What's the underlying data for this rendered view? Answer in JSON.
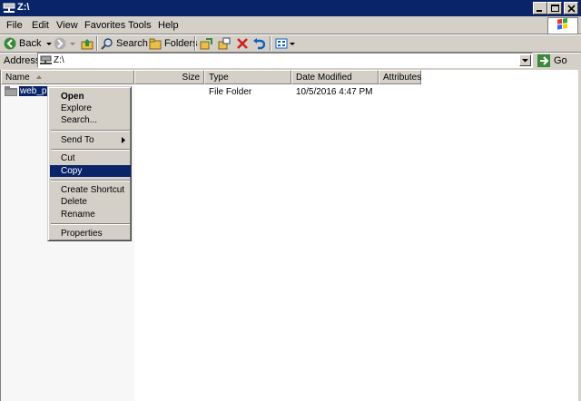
{
  "window": {
    "title": "Z:\\"
  },
  "menu": [
    "File",
    "Edit",
    "View",
    "Favorites",
    "Tools",
    "Help"
  ],
  "toolbar": {
    "back_label": "Back",
    "search_label": "Search",
    "folders_label": "Folders"
  },
  "address": {
    "label": "Address",
    "value": "Z:\\",
    "go_label": "Go"
  },
  "columns": {
    "name": "Name",
    "size": "Size",
    "type": "Type",
    "date_modified": "Date Modified",
    "attributes": "Attributes"
  },
  "file": {
    "name": "web_pu",
    "type": "File Folder",
    "date_modified": "10/5/2016 4:47 PM"
  },
  "context_menu": {
    "open": "Open",
    "explore": "Explore",
    "search": "Search...",
    "send_to": "Send To",
    "cut": "Cut",
    "copy": "Copy",
    "create_shortcut": "Create Shortcut",
    "delete": "Delete",
    "rename": "Rename",
    "properties": "Properties"
  },
  "colors": {
    "titlebar": "#0a246a",
    "selection": "#0a246a",
    "chrome": "#d4d0c8"
  }
}
